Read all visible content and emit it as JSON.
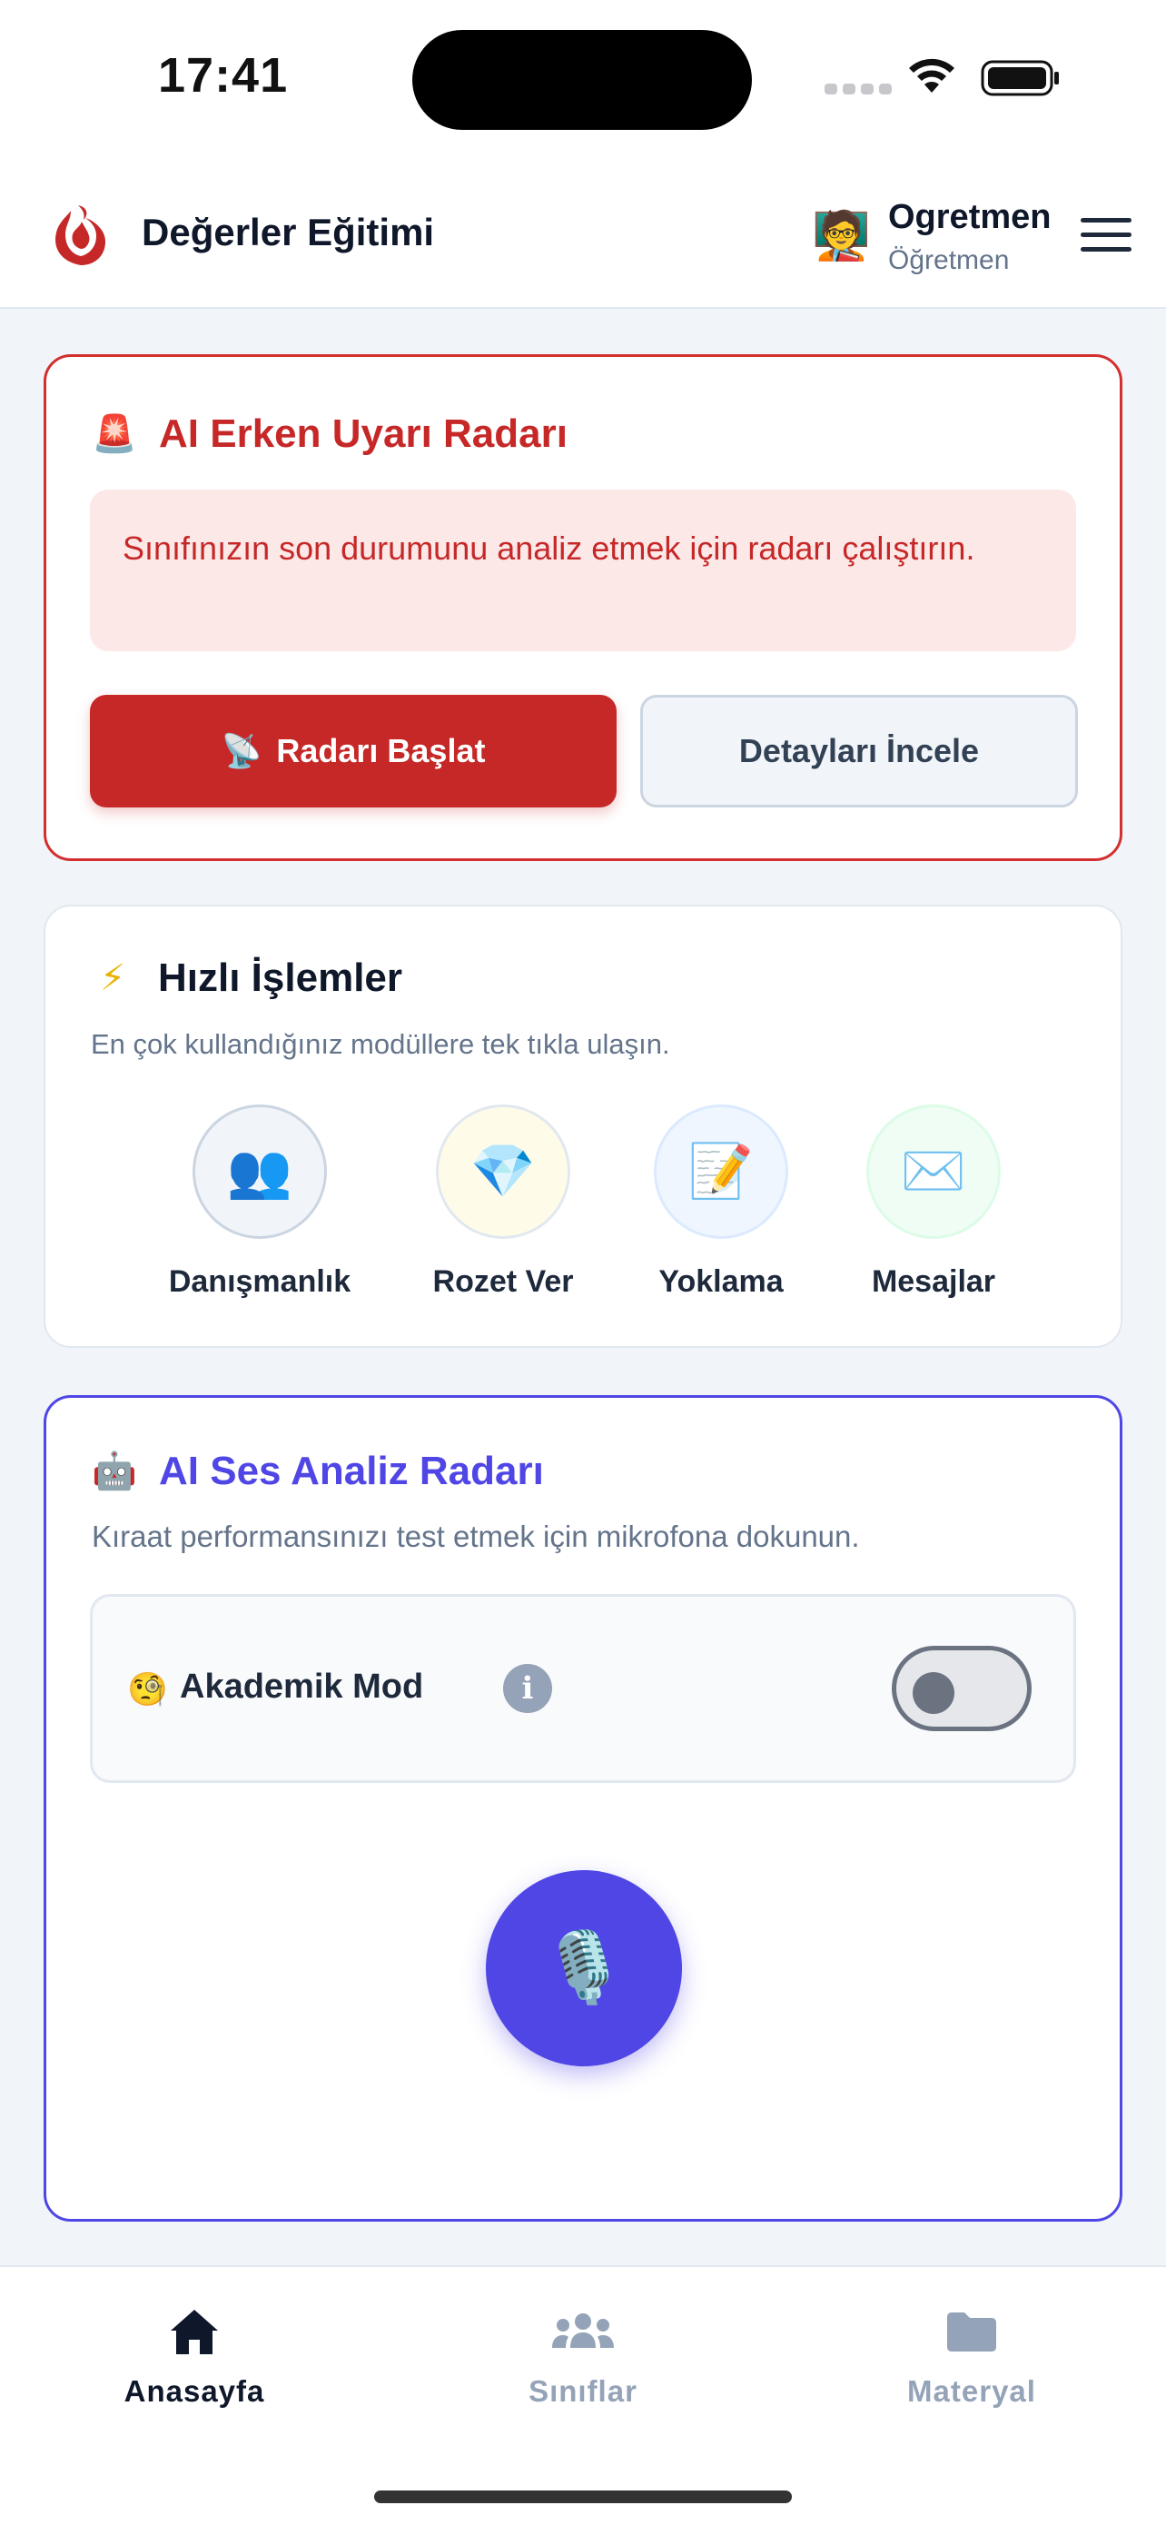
{
  "status_bar": {
    "time": "17:41"
  },
  "header": {
    "app_title": "Değerler Eğitimi",
    "user_emoji": "🧑‍🏫",
    "user_name": "Ogretmen",
    "user_role": "Öğretmen",
    "logo_color": "#c62828"
  },
  "alert_card": {
    "icon": "🚨",
    "title": "AI Erken Uyarı Radarı",
    "message": "Sınıfınızın son durumunu analiz etmek için radarı çalıştırın.",
    "start_button_icon": "📡",
    "start_button_label": "Radarı Başlat",
    "detail_button_label": "Detayları İncele",
    "accent_color": "#d32f2f"
  },
  "quick_actions": {
    "icon": "⚡",
    "title": "Hızlı İşlemler",
    "subtitle": "En çok kullandığınız modüllere tek tıkla ulaşın.",
    "items": [
      {
        "label": "Danışmanlık",
        "emoji": "👥",
        "bg": "#f1f5f9"
      },
      {
        "label": "Rozet Ver",
        "emoji": "💎",
        "bg": "#fefce8"
      },
      {
        "label": "Yoklama",
        "emoji": "📝",
        "bg": "#eff6ff"
      },
      {
        "label": "Mesajlar",
        "emoji": "✉️",
        "bg": "#f0fdf4"
      }
    ]
  },
  "voice_card": {
    "icon": "🤖",
    "title": "AI Ses Analiz Radarı",
    "subtitle": "Kıraat performansınızı test etmek için mikrofona dokunun.",
    "mode_emoji": "🧐",
    "mode_label": "Akademik Mod",
    "info_glyph": "i",
    "mode_enabled": false,
    "mic_emoji": "🎙️",
    "accent_color": "#4f46e5"
  },
  "tab_bar": {
    "tabs": [
      {
        "label": "Anasayfa",
        "icon": "home-icon",
        "active": true
      },
      {
        "label": "Sınıflar",
        "icon": "users-icon",
        "active": false
      },
      {
        "label": "Materyal",
        "icon": "folder-icon",
        "active": false
      }
    ]
  }
}
